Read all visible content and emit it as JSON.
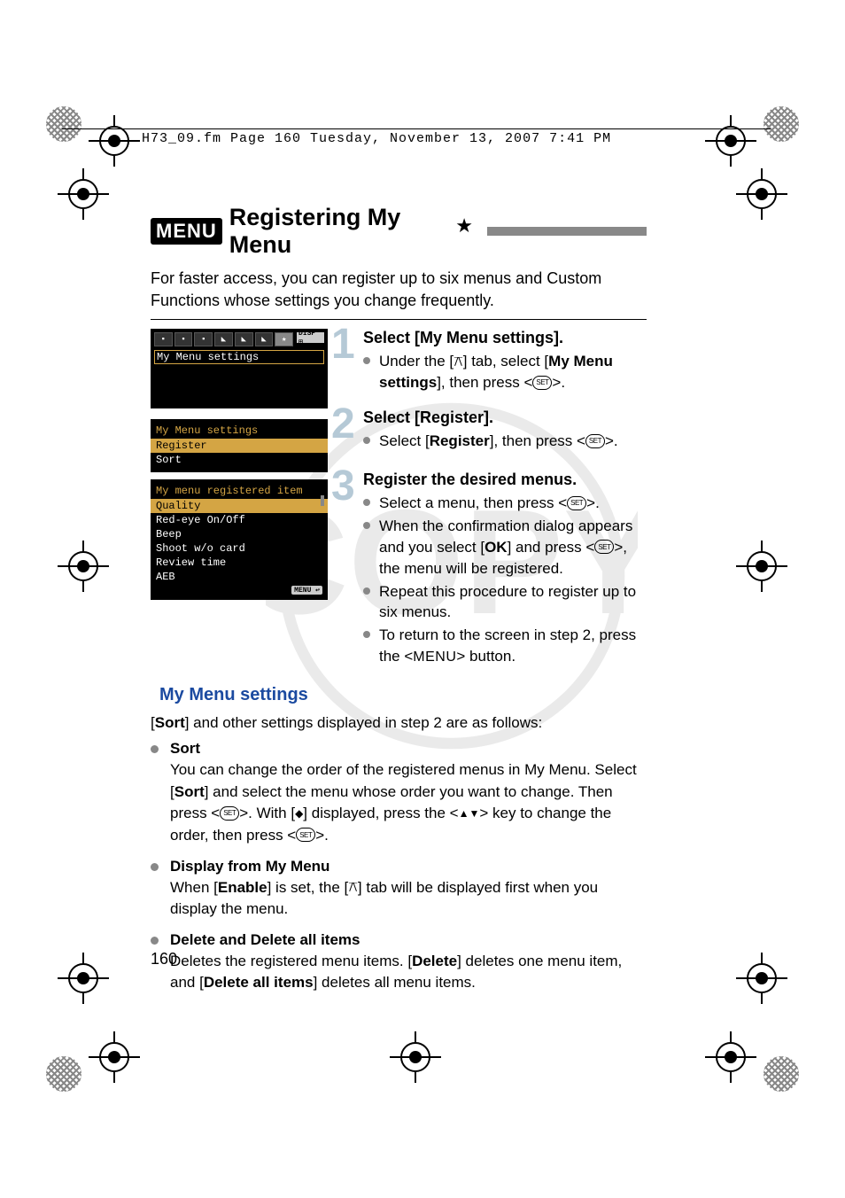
{
  "header": "H73_09.fm  Page 160  Tuesday, November 13, 2007  7:41 PM",
  "title": {
    "menu_badge": "MENU",
    "text": "Registering My Menu",
    "star": "★"
  },
  "intro": "For faster access, you can register up to six menus and Custom Functions whose settings you change frequently.",
  "lcd1": {
    "row1": "My Menu settings"
  },
  "lcd2": {
    "title": "My Menu settings",
    "rows": [
      "Register",
      "Sort"
    ]
  },
  "lcd3": {
    "title": "My menu registered item",
    "rows": [
      "Quality",
      "Red-eye On/Off",
      "Beep",
      "Shoot w/o card",
      "Review time",
      "AEB"
    ],
    "footer": "MENU ↩"
  },
  "steps": {
    "s1": {
      "num": "1",
      "head": "Select [My Menu settings].",
      "b1a": "Under the [",
      "b1b": "] tab, select [",
      "b1c": "My Menu settings",
      "b1d": "], then press <",
      "b1e": ">.",
      "set": "SET"
    },
    "s2": {
      "num": "2",
      "head": "Select [Register].",
      "b1a": "Select [",
      "b1b": "Register",
      "b1c": "], then press <",
      "b1d": ">.",
      "set": "SET"
    },
    "s3": {
      "num": "3",
      "head": "Register the desired menus.",
      "b1a": "Select a menu, then press <",
      "b1b": ">.",
      "b2a": "When the confirmation dialog appears and you select [",
      "b2b": "OK",
      "b2c": "] and press <",
      "b2d": ">, the menu will be registered.",
      "b3": "Repeat this procedure to register up to six menus.",
      "b4a": "To return to the screen in step 2, press the <",
      "b4b": "> button.",
      "menu_word": "MENU",
      "set": "SET"
    }
  },
  "sub": {
    "heading": "My Menu settings",
    "lead_a": "[",
    "lead_b": "Sort",
    "lead_c": "] and other settings displayed in step 2 are as follows:",
    "sort": {
      "head": "Sort",
      "body_a": "You can change the order of the registered menus in My Menu. Select [",
      "body_b": "Sort",
      "body_c": "] and select the menu whose order you want to change. Then press <",
      "body_d": ">. With [",
      "body_e": "] displayed, press the <",
      "body_f": "> key to change the order, then press <",
      "body_g": ">.",
      "set": "SET"
    },
    "display": {
      "head": "Display from My Menu",
      "body_a": "When [",
      "body_b": "Enable",
      "body_c": "] is set, the [",
      "body_d": "] tab will be displayed first when you display the menu."
    },
    "delete": {
      "head": "Delete and Delete all items",
      "body_a": "Deletes the registered menu items. [",
      "body_b": "Delete",
      "body_c": "] deletes one menu item, and [",
      "body_d": "Delete all items",
      "body_e": "] deletes all menu items."
    }
  },
  "page_number": "160",
  "icons": {
    "mymenu_glyph": "⚻",
    "updown": "▲▼",
    "diamond_updown": "◆"
  }
}
